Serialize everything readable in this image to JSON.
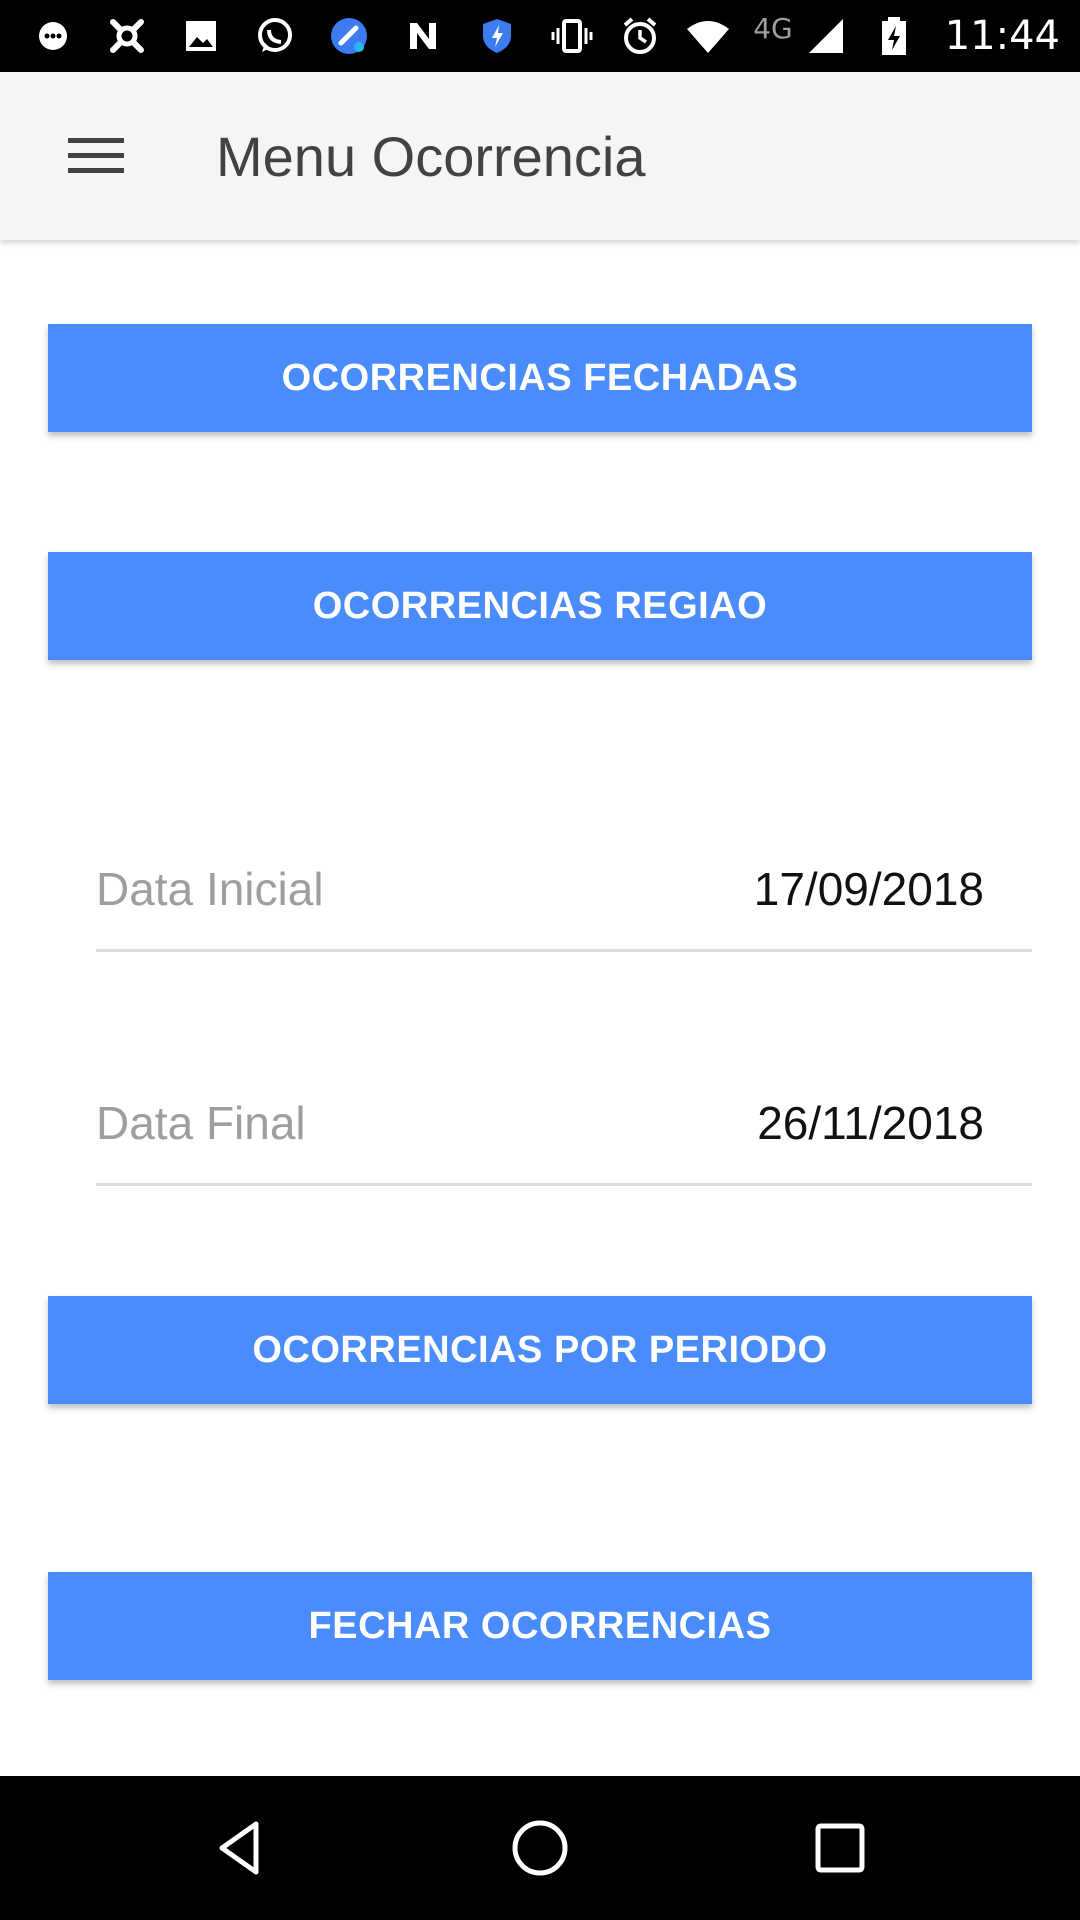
{
  "status_bar": {
    "left_icons": [
      "messenger-icon",
      "app-icon",
      "gallery-icon",
      "whatsapp-icon",
      "cleaner-icon",
      "n-app-icon",
      "shield-icon"
    ],
    "right_icons": [
      "vibrate-icon",
      "alarm-icon",
      "wifi-icon",
      "signal-icon",
      "battery-charging-icon"
    ],
    "network": "4G",
    "time": "11:44"
  },
  "app_bar": {
    "menu_icon": "hamburger-menu-icon",
    "title": "Menu Ocorrencia"
  },
  "main": {
    "btn_fechadas": "OCORRENCIAS FECHADAS",
    "btn_regiao": "OCORRENCIAS REGIAO",
    "data_inicial": {
      "label": "Data Inicial",
      "value": "17/09/2018"
    },
    "data_final": {
      "label": "Data Final",
      "value": "26/11/2018"
    },
    "btn_periodo": "OCORRENCIAS POR PERIODO",
    "btn_fechar": "FECHAR OCORRENCIAS"
  },
  "nav_bar": {
    "icons": [
      "back-icon",
      "home-icon",
      "recents-icon"
    ]
  },
  "colors": {
    "accent": "#4a8cfb",
    "app_bar_bg": "#f5f5f5",
    "status_bar_bg": "#000000"
  }
}
